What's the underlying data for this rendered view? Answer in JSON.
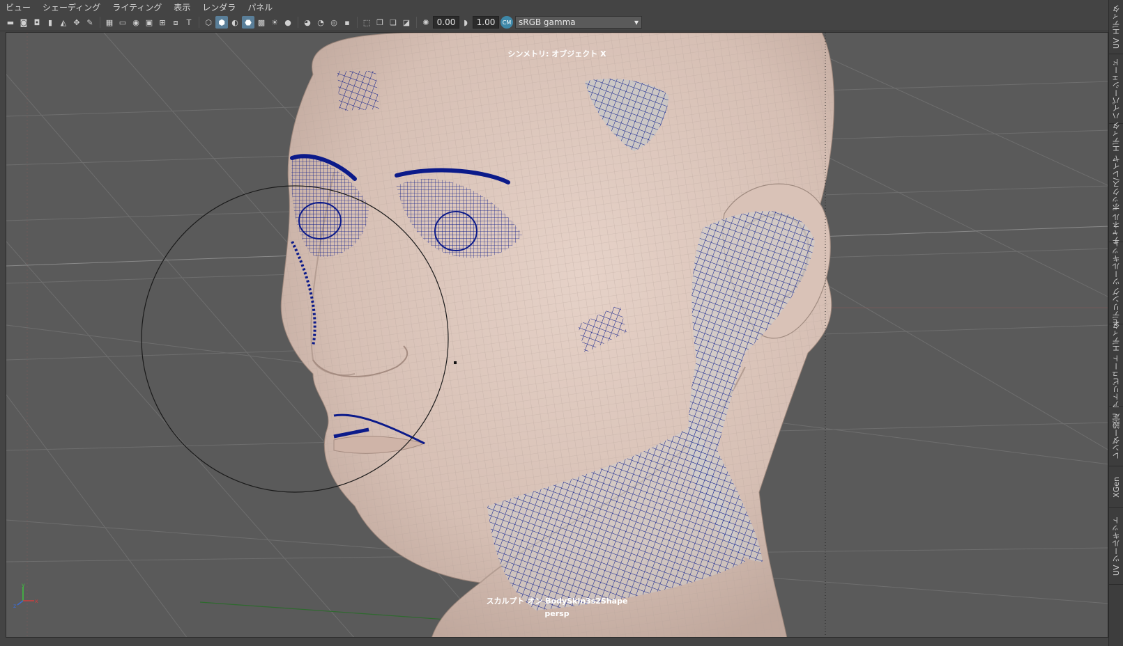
{
  "menubar": {
    "items": [
      "ビュー",
      "シェーディング",
      "ライティング",
      "表示",
      "レンダラ",
      "パネル"
    ]
  },
  "toolbar": {
    "icons": [
      "camera-icon",
      "camera-attr-icon",
      "bookmark-camera-icon",
      "bookmark-icon",
      "image-plane-icon",
      "pan-zoom-icon",
      "grease-pencil-icon",
      "grid-icon",
      "film-gate-icon",
      "resolution-gate-icon",
      "gate-mask-icon",
      "field-chart-icon",
      "safe-action-icon",
      "safe-title-icon",
      "wireframe-icon",
      "smooth-shade-icon",
      "default-material-icon",
      "wireframe-on-shaded-icon",
      "textured-icon",
      "use-lights-icon",
      "shadows-icon",
      "ambient-occlusion-icon",
      "motion-blur-icon",
      "anti-aliasing-icon",
      "depth-of-field-icon",
      "xray-icon",
      "xray-joints-icon",
      "backface-cull-icon",
      "isolate-select-icon",
      "exposure-icon",
      "gamma-icon"
    ],
    "exposure_value": "0.00",
    "gamma_value": "1.00",
    "colorspace_label": "sRGB gamma",
    "colorspace_icon": "color-management-icon"
  },
  "viewport": {
    "hud_symmetry": "シンメトリ: オブジェクト X",
    "hud_sculpt_target": "スカルプト オン BodySkin3s2Shape",
    "camera_name": "persp",
    "accent_color": "#0b1a8a",
    "skin_color": "#dcc6bc"
  },
  "right_dock": {
    "tabs": [
      "UV エディタ",
      "ハイパーシェード",
      "チャネル ボックス/レイヤ エディタ",
      "モデリング ツールキット",
      "アトリビュート エディタ",
      "レンダー設定",
      "XGen",
      "UV ツールキット"
    ]
  },
  "axis": {
    "x": "x",
    "y": "y",
    "z": "z"
  }
}
